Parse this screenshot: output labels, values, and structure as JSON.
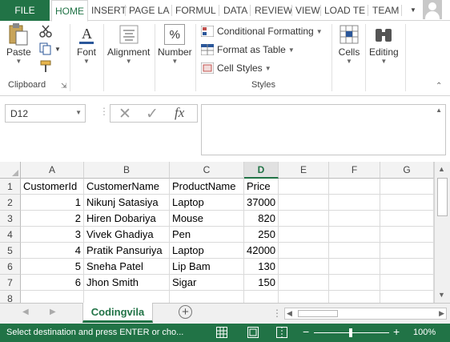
{
  "ribbon_tabs": {
    "file": "FILE",
    "home": "HOME",
    "insert": "INSERT",
    "page_layout": "PAGE LA",
    "formulas": "FORMUL",
    "data": "DATA",
    "review": "REVIEW",
    "view": "VIEW",
    "load_test": "LOAD TE",
    "team": "TEAM"
  },
  "ribbon": {
    "clipboard": {
      "paste": "Paste",
      "label": "Clipboard"
    },
    "font": {
      "label": "Font"
    },
    "alignment": {
      "label": "Alignment"
    },
    "number": {
      "label": "Number",
      "icon_text": "%"
    },
    "styles": {
      "conditional": "Conditional Formatting",
      "format_table": "Format as Table",
      "cell_styles": "Cell Styles",
      "label": "Styles"
    },
    "cells": {
      "label": "Cells"
    },
    "editing": {
      "label": "Editing"
    }
  },
  "formula_bar": {
    "name_box": "D12",
    "fx": "fx",
    "formula": ""
  },
  "grid": {
    "columns": [
      "A",
      "B",
      "C",
      "D",
      "E",
      "F",
      "G"
    ],
    "rows": [
      "1",
      "2",
      "3",
      "4",
      "5",
      "6",
      "7",
      "8"
    ],
    "headers": [
      "CustomerId",
      "CustomerName",
      "ProductName",
      "Price"
    ],
    "data": [
      [
        "1",
        "Nikunj Satasiya",
        "Laptop",
        "37000"
      ],
      [
        "2",
        "Hiren Dobariya",
        "Mouse",
        "820"
      ],
      [
        "3",
        "Vivek Ghadiya",
        "Pen",
        "250"
      ],
      [
        "4",
        "Pratik Pansuriya",
        "Laptop",
        "42000"
      ],
      [
        "5",
        "Sneha Patel",
        "Lip Bam",
        "130"
      ],
      [
        "6",
        "Jhon Smith",
        "Sigar",
        "150"
      ]
    ]
  },
  "sheet_tabs": {
    "active": "Codingvila"
  },
  "status": {
    "message": "Select destination and press ENTER or cho...",
    "zoom": "100%"
  },
  "colors": {
    "accent": "#217346"
  }
}
